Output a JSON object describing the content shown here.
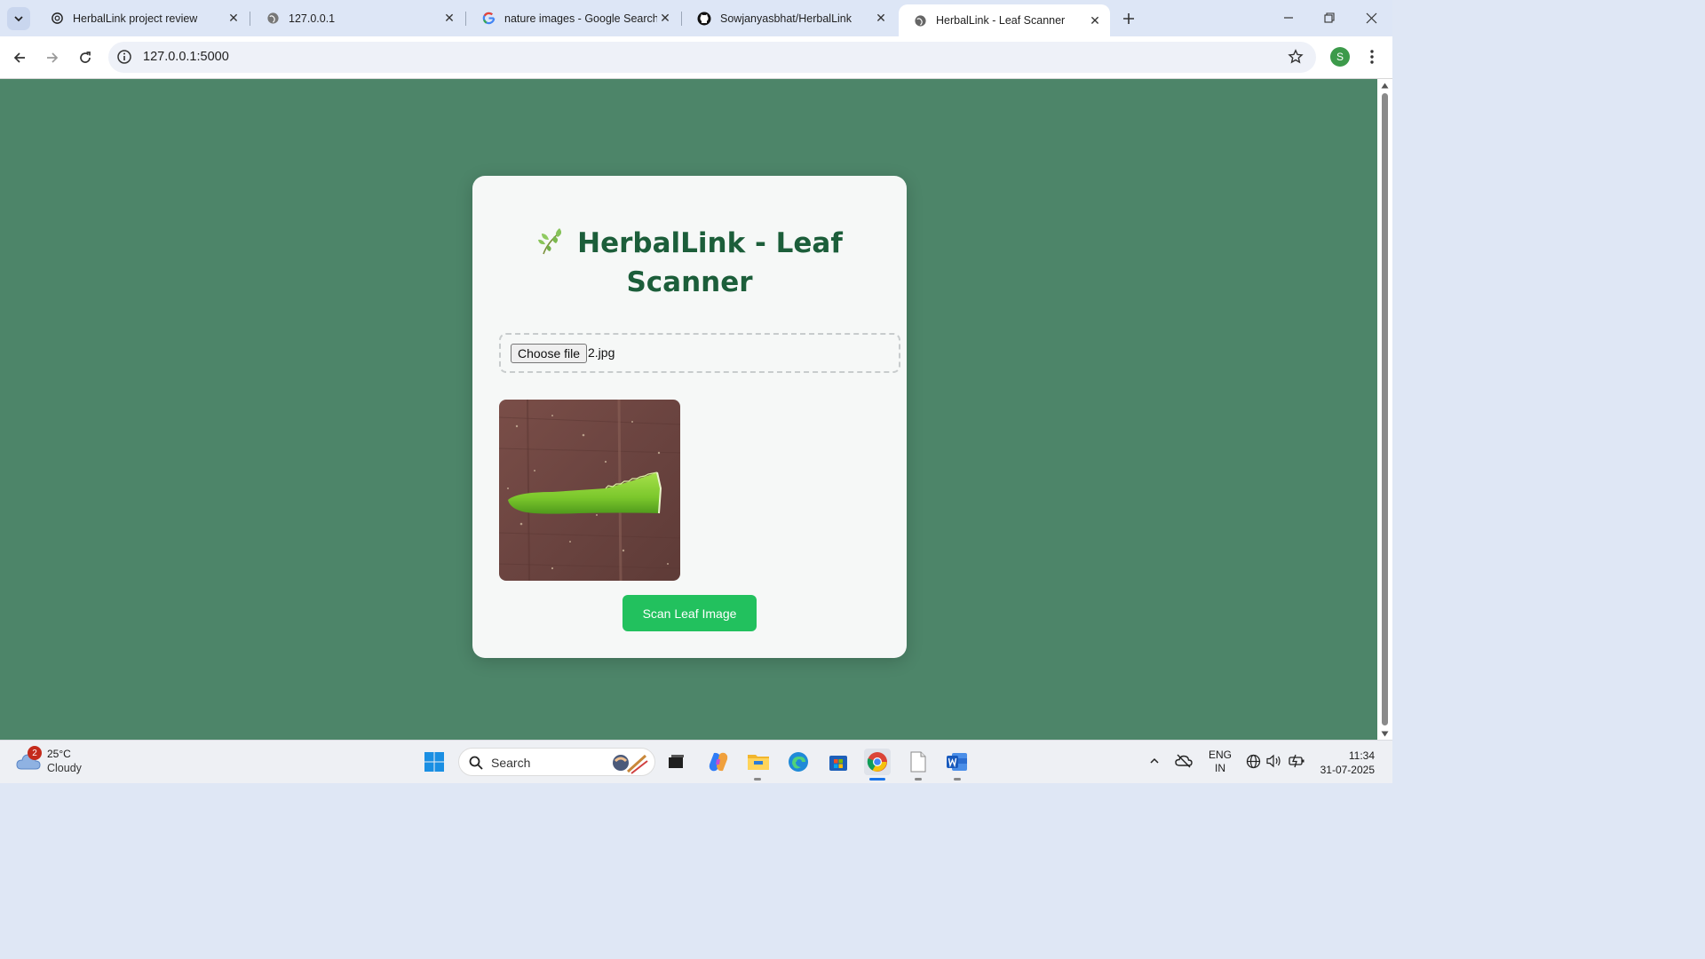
{
  "browser": {
    "tabs": [
      {
        "title": "HerbalLink project review",
        "active": false
      },
      {
        "title": "127.0.0.1",
        "active": false
      },
      {
        "title": "nature images - Google Search",
        "active": false
      },
      {
        "title": "Sowjanyasbhat/HerbalLink",
        "active": false
      },
      {
        "title": "HerbalLink - Leaf Scanner",
        "active": true
      }
    ],
    "url": "127.0.0.1:5000",
    "profile_initial": "S"
  },
  "page": {
    "heading": "HerbalLink - Leaf Scanner",
    "heading_icon": "herb-leaf-icon",
    "file_input": {
      "button_label": "Choose file",
      "selected_file": "2.jpg"
    },
    "preview": {
      "subject": "aloe vera leaf on brown wooden surface"
    },
    "scan_button": "Scan Leaf Image",
    "colors": {
      "background": "#4d8569",
      "card": "#f6f8f7",
      "heading": "#1c5e3a",
      "button": "#22c15e"
    }
  },
  "taskbar": {
    "weather": {
      "temp": "25°C",
      "desc": "Cloudy",
      "badge": "2"
    },
    "search_label": "Search",
    "language": {
      "line1": "ENG",
      "line2": "IN"
    },
    "clock": {
      "time": "11:34",
      "date": "31-07-2025"
    }
  }
}
